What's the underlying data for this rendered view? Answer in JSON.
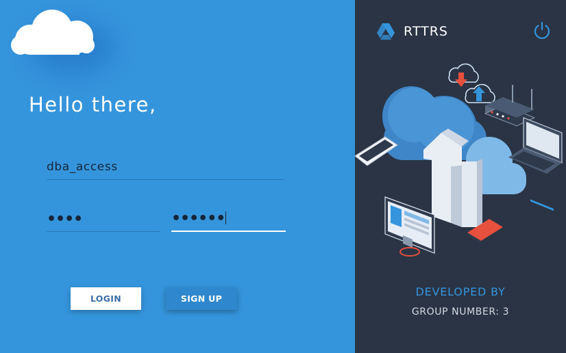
{
  "login": {
    "greeting": "Hello there,",
    "username_value": "dba_access",
    "password_value": "••••",
    "confirm_password_value": "••••••",
    "login_label": "LOGIN",
    "signup_label": "SIGN UP"
  },
  "brand": {
    "name": "RTTRS"
  },
  "footer": {
    "developed_by": "DEVELOPED BY",
    "group_number": "GROUP NUMBER: 3"
  },
  "colors": {
    "left_background": "#3595dc",
    "right_background": "#2a3444",
    "accent": "#3595dc",
    "signup_button": "#2f88cd"
  },
  "icons": {
    "cloud_logo": "cloud-icon",
    "brand_logo": "triangle-logo-icon",
    "power": "power-icon"
  }
}
